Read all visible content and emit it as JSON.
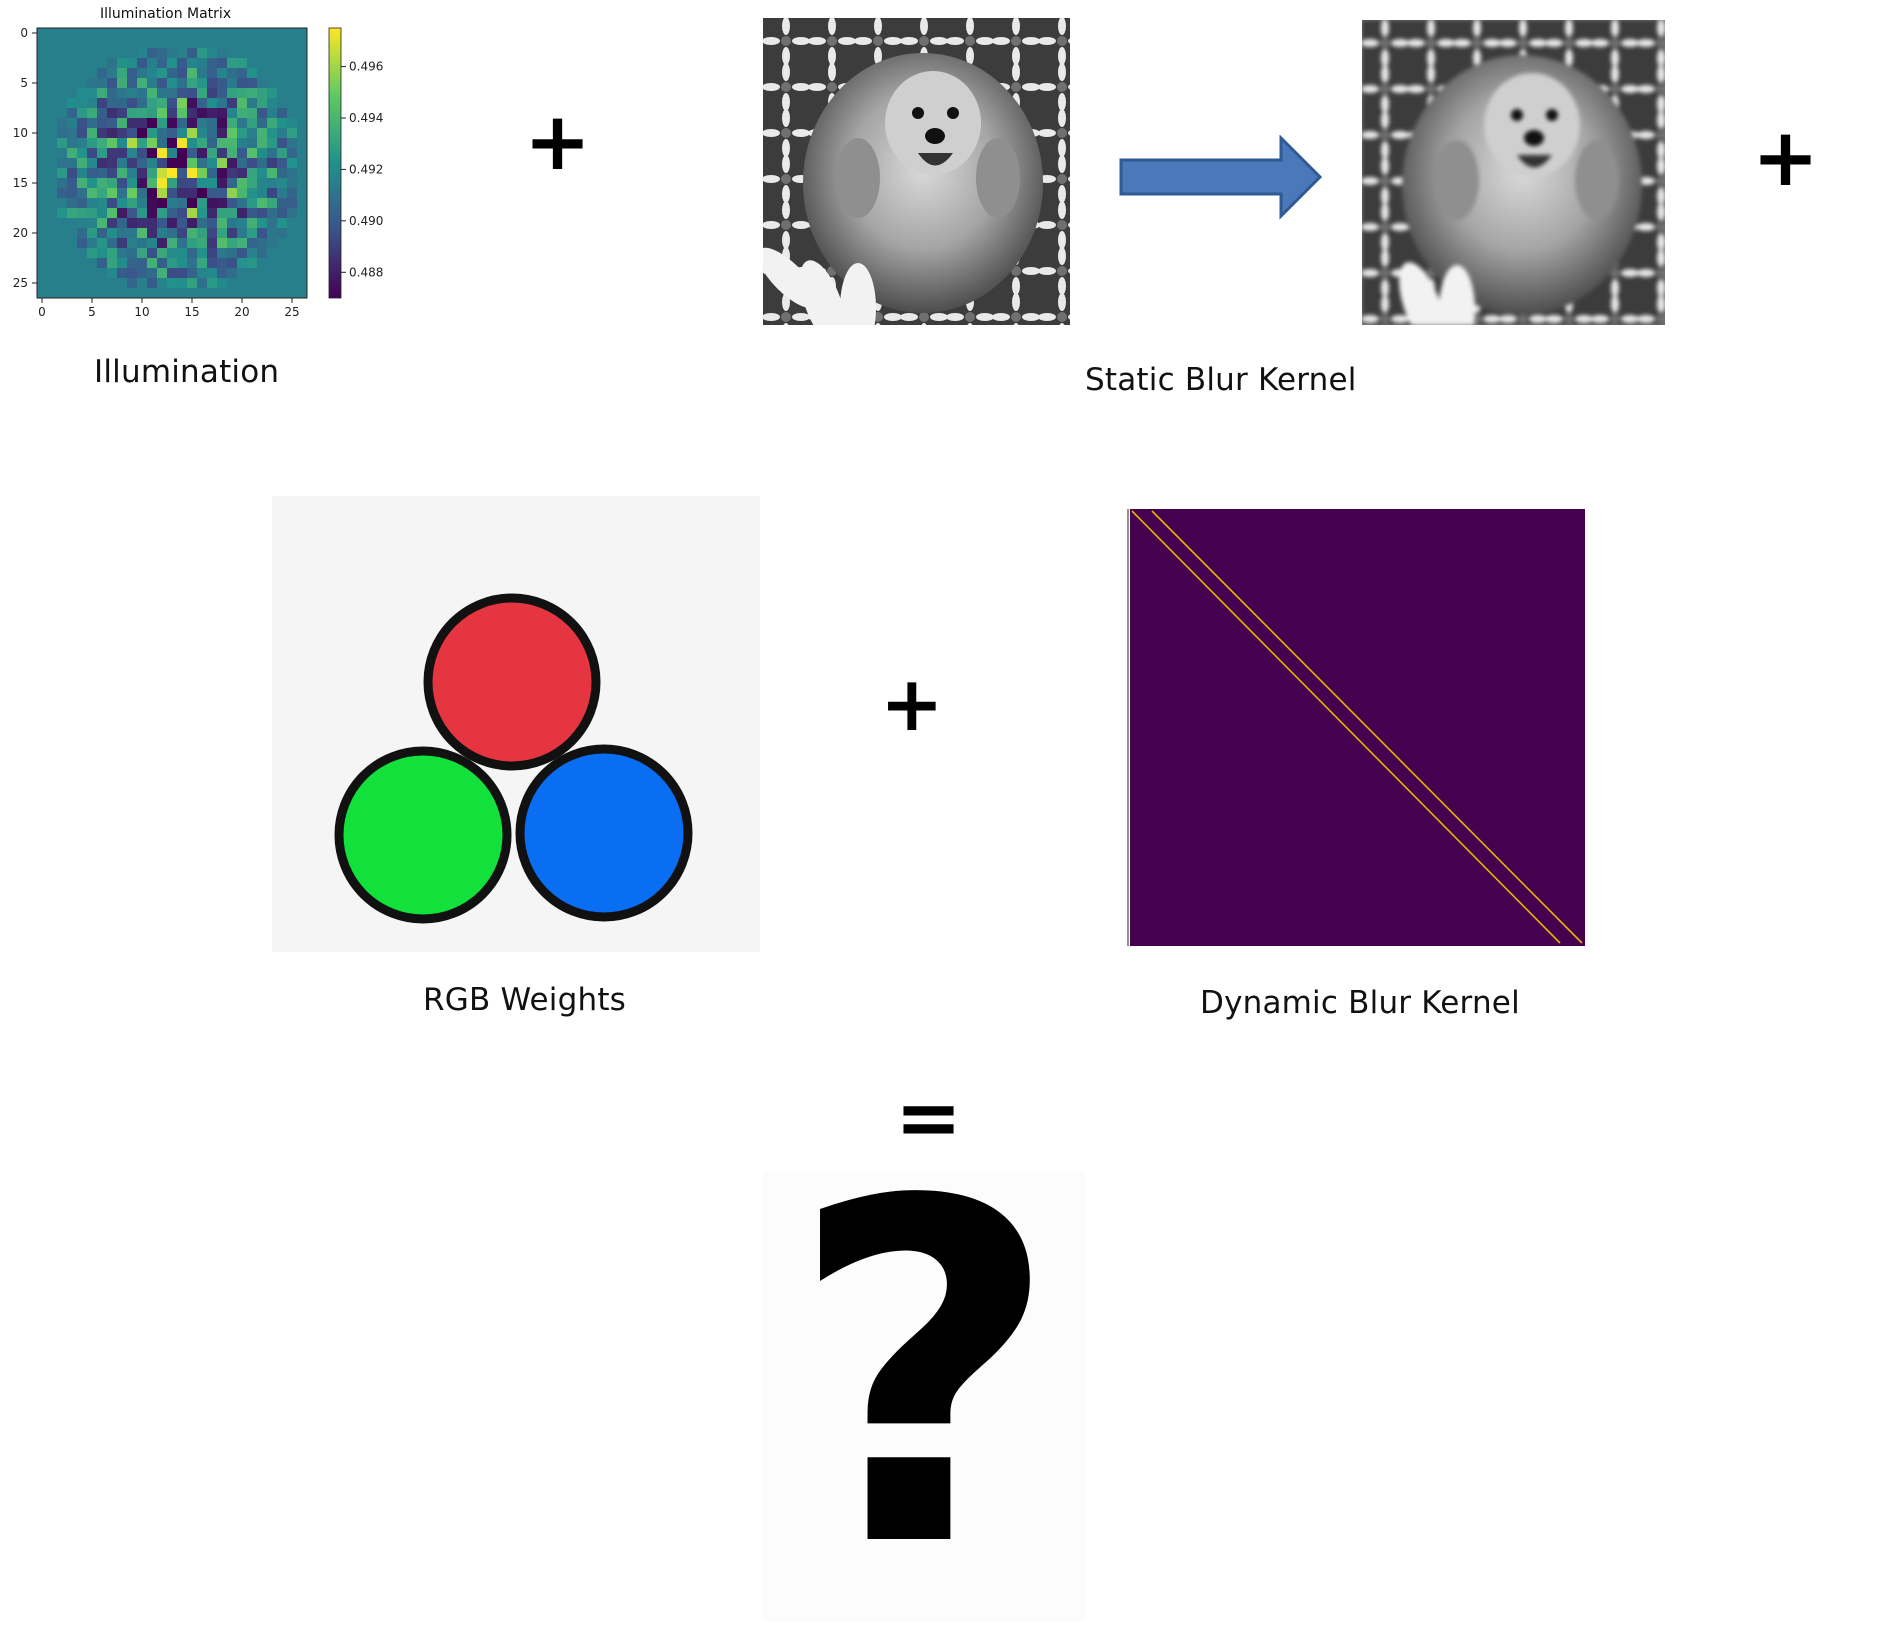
{
  "captions": {
    "illumination": "Illumination",
    "static_blur_kernel": "Static Blur Kernel",
    "rgb_weights": "RGB Weights",
    "dynamic_blur_kernel": "Dynamic Blur Kernel"
  },
  "operators": {
    "plus": "+",
    "equals": "="
  },
  "result_symbol": "?",
  "colors": {
    "viridis_low": "#440154",
    "viridis_mid": "#21918c",
    "viridis_high": "#fde725",
    "arrow_fill": "#4a78b8",
    "arrow_stroke": "#2f5a94",
    "rgb_red": "#e43540",
    "rgb_green": "#12e03b",
    "rgb_blue": "#0a6ef2",
    "kernel_bg": "#45014f",
    "kernel_line": "#e8b400"
  },
  "chart_data": {
    "type": "heatmap",
    "title": "Illumination Matrix",
    "xticks": [
      0,
      5,
      10,
      15,
      20,
      25
    ],
    "yticks": [
      0,
      5,
      10,
      15,
      20,
      25
    ],
    "xlim": [
      0,
      27
    ],
    "ylim": [
      0,
      27
    ],
    "colorbar_ticks": [
      "0.488",
      "0.490",
      "0.492",
      "0.494",
      "0.496"
    ],
    "colorbar_range": [
      0.487,
      0.4975
    ],
    "background_value": 0.4915
  }
}
